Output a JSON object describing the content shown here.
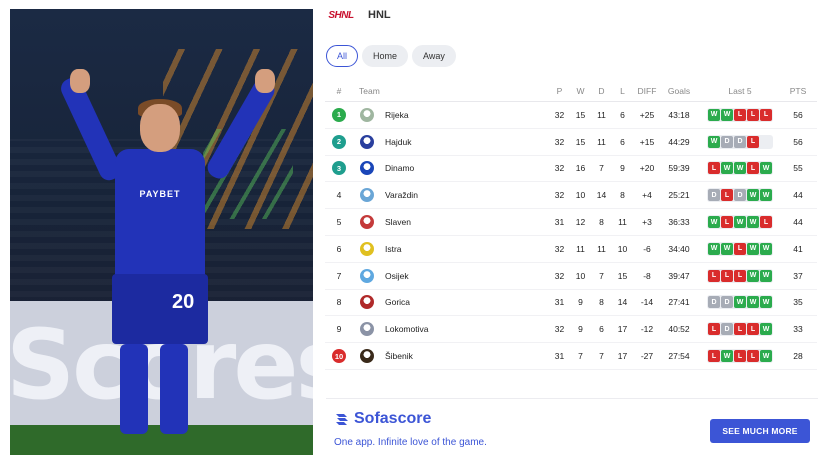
{
  "photo": {
    "board_text": "Scores.",
    "sponsor": "PAYBET",
    "shirt_number": "20"
  },
  "league": {
    "logo_text": "SHNL",
    "name": "HNL"
  },
  "filters": [
    {
      "label": "All",
      "active": true
    },
    {
      "label": "Home",
      "active": false
    },
    {
      "label": "Away",
      "active": false
    }
  ],
  "columns": {
    "pos": "#",
    "team": "Team",
    "played": "P",
    "won": "W",
    "drawn": "D",
    "lost": "L",
    "diff": "DIFF",
    "goals": "Goals",
    "last5": "Last 5",
    "pts": "PTS"
  },
  "colors": {
    "accent": "#3c55d6",
    "win": "#2bab4d",
    "loss": "#d92c2c",
    "draw": "#a7acb6",
    "pos_green": "#2bab4d",
    "pos_teal": "#1f9e8e",
    "pos_red": "#d92c2c"
  },
  "standings": [
    {
      "pos": "1",
      "badge": "green",
      "team": "Rijeka",
      "crest_icon": "rijeka-crest-icon",
      "crest_color": "#9fb6a0",
      "p": "32",
      "w": "15",
      "d": "11",
      "l": "6",
      "diff": "+25",
      "goals": "43:18",
      "form": [
        "W",
        "W",
        "L",
        "L",
        "L"
      ],
      "pts": "56"
    },
    {
      "pos": "2",
      "badge": "teal",
      "team": "Hajduk",
      "crest_icon": "hajduk-crest-icon",
      "crest_color": "#2a3f9e",
      "p": "32",
      "w": "15",
      "d": "11",
      "l": "6",
      "diff": "+15",
      "goals": "44:29",
      "form": [
        "W",
        "D",
        "D",
        "L",
        ""
      ],
      "pts": "56"
    },
    {
      "pos": "3",
      "badge": "teal",
      "team": "Dinamo",
      "crest_icon": "dinamo-crest-icon",
      "crest_color": "#1a46b8",
      "p": "32",
      "w": "16",
      "d": "7",
      "l": "9",
      "diff": "+20",
      "goals": "59:39",
      "form": [
        "L",
        "W",
        "W",
        "L",
        "W"
      ],
      "pts": "55"
    },
    {
      "pos": "4",
      "badge": "",
      "team": "Varaždin",
      "crest_icon": "varazdin-crest-icon",
      "crest_color": "#6aa6d6",
      "p": "32",
      "w": "10",
      "d": "14",
      "l": "8",
      "diff": "+4",
      "goals": "25:21",
      "form": [
        "D",
        "L",
        "D",
        "W",
        "W"
      ],
      "pts": "44"
    },
    {
      "pos": "5",
      "badge": "",
      "team": "Slaven",
      "crest_icon": "slaven-crest-icon",
      "crest_color": "#c43a3a",
      "p": "31",
      "w": "12",
      "d": "8",
      "l": "11",
      "diff": "+3",
      "goals": "36:33",
      "form": [
        "W",
        "L",
        "W",
        "W",
        "L"
      ],
      "pts": "44"
    },
    {
      "pos": "6",
      "badge": "",
      "team": "Istra",
      "crest_icon": "istra-crest-icon",
      "crest_color": "#e0c020",
      "p": "32",
      "w": "11",
      "d": "11",
      "l": "10",
      "diff": "-6",
      "goals": "34:40",
      "form": [
        "W",
        "W",
        "L",
        "W",
        "W"
      ],
      "pts": "41"
    },
    {
      "pos": "7",
      "badge": "",
      "team": "Osijek",
      "crest_icon": "osijek-crest-icon",
      "crest_color": "#5fa8e0",
      "p": "32",
      "w": "10",
      "d": "7",
      "l": "15",
      "diff": "-8",
      "goals": "39:47",
      "form": [
        "L",
        "L",
        "L",
        "W",
        "W"
      ],
      "pts": "37"
    },
    {
      "pos": "8",
      "badge": "",
      "team": "Gorica",
      "crest_icon": "gorica-crest-icon",
      "crest_color": "#b02a2a",
      "p": "31",
      "w": "9",
      "d": "8",
      "l": "14",
      "diff": "-14",
      "goals": "27:41",
      "form": [
        "D",
        "D",
        "W",
        "W",
        "W"
      ],
      "pts": "35"
    },
    {
      "pos": "9",
      "badge": "",
      "team": "Lokomotiva",
      "crest_icon": "lokomotiva-crest-icon",
      "crest_color": "#8b93a6",
      "p": "32",
      "w": "9",
      "d": "6",
      "l": "17",
      "diff": "-12",
      "goals": "40:52",
      "form": [
        "L",
        "D",
        "L",
        "L",
        "W"
      ],
      "pts": "33"
    },
    {
      "pos": "10",
      "badge": "red",
      "team": "Šibenik",
      "crest_icon": "sibenik-crest-icon",
      "crest_color": "#3a2a1a",
      "p": "31",
      "w": "7",
      "d": "7",
      "l": "17",
      "diff": "-27",
      "goals": "27:54",
      "form": [
        "L",
        "W",
        "L",
        "L",
        "W"
      ],
      "pts": "28"
    }
  ],
  "promo": {
    "brand": "Sofascore",
    "tagline": "One app. Infinite love of the game.",
    "button": "SEE MUCH MORE"
  }
}
